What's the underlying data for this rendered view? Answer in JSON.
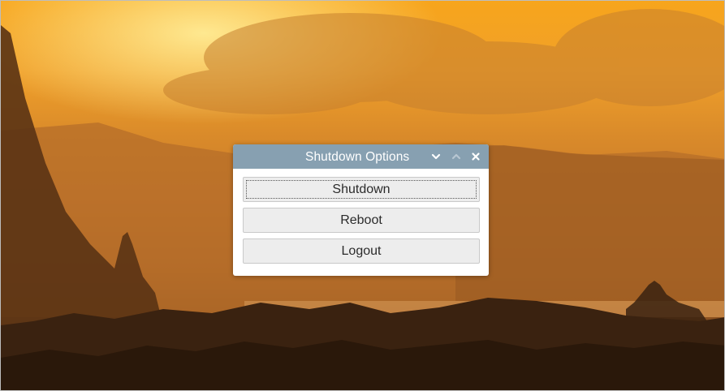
{
  "dialog": {
    "title": "Shutdown Options",
    "controls": {
      "minimize_icon": "chevron-down-icon",
      "maximize_icon": "chevron-up-icon",
      "close_icon": "close-icon"
    },
    "buttons": [
      {
        "label": "Shutdown",
        "focused": true
      },
      {
        "label": "Reboot",
        "focused": false
      },
      {
        "label": "Logout",
        "focused": false
      }
    ]
  },
  "colors": {
    "titlebar": "#87a0b1",
    "button_bg": "#ededed",
    "sky_light": "#f7a51c",
    "silhouette": "#3a2210"
  }
}
